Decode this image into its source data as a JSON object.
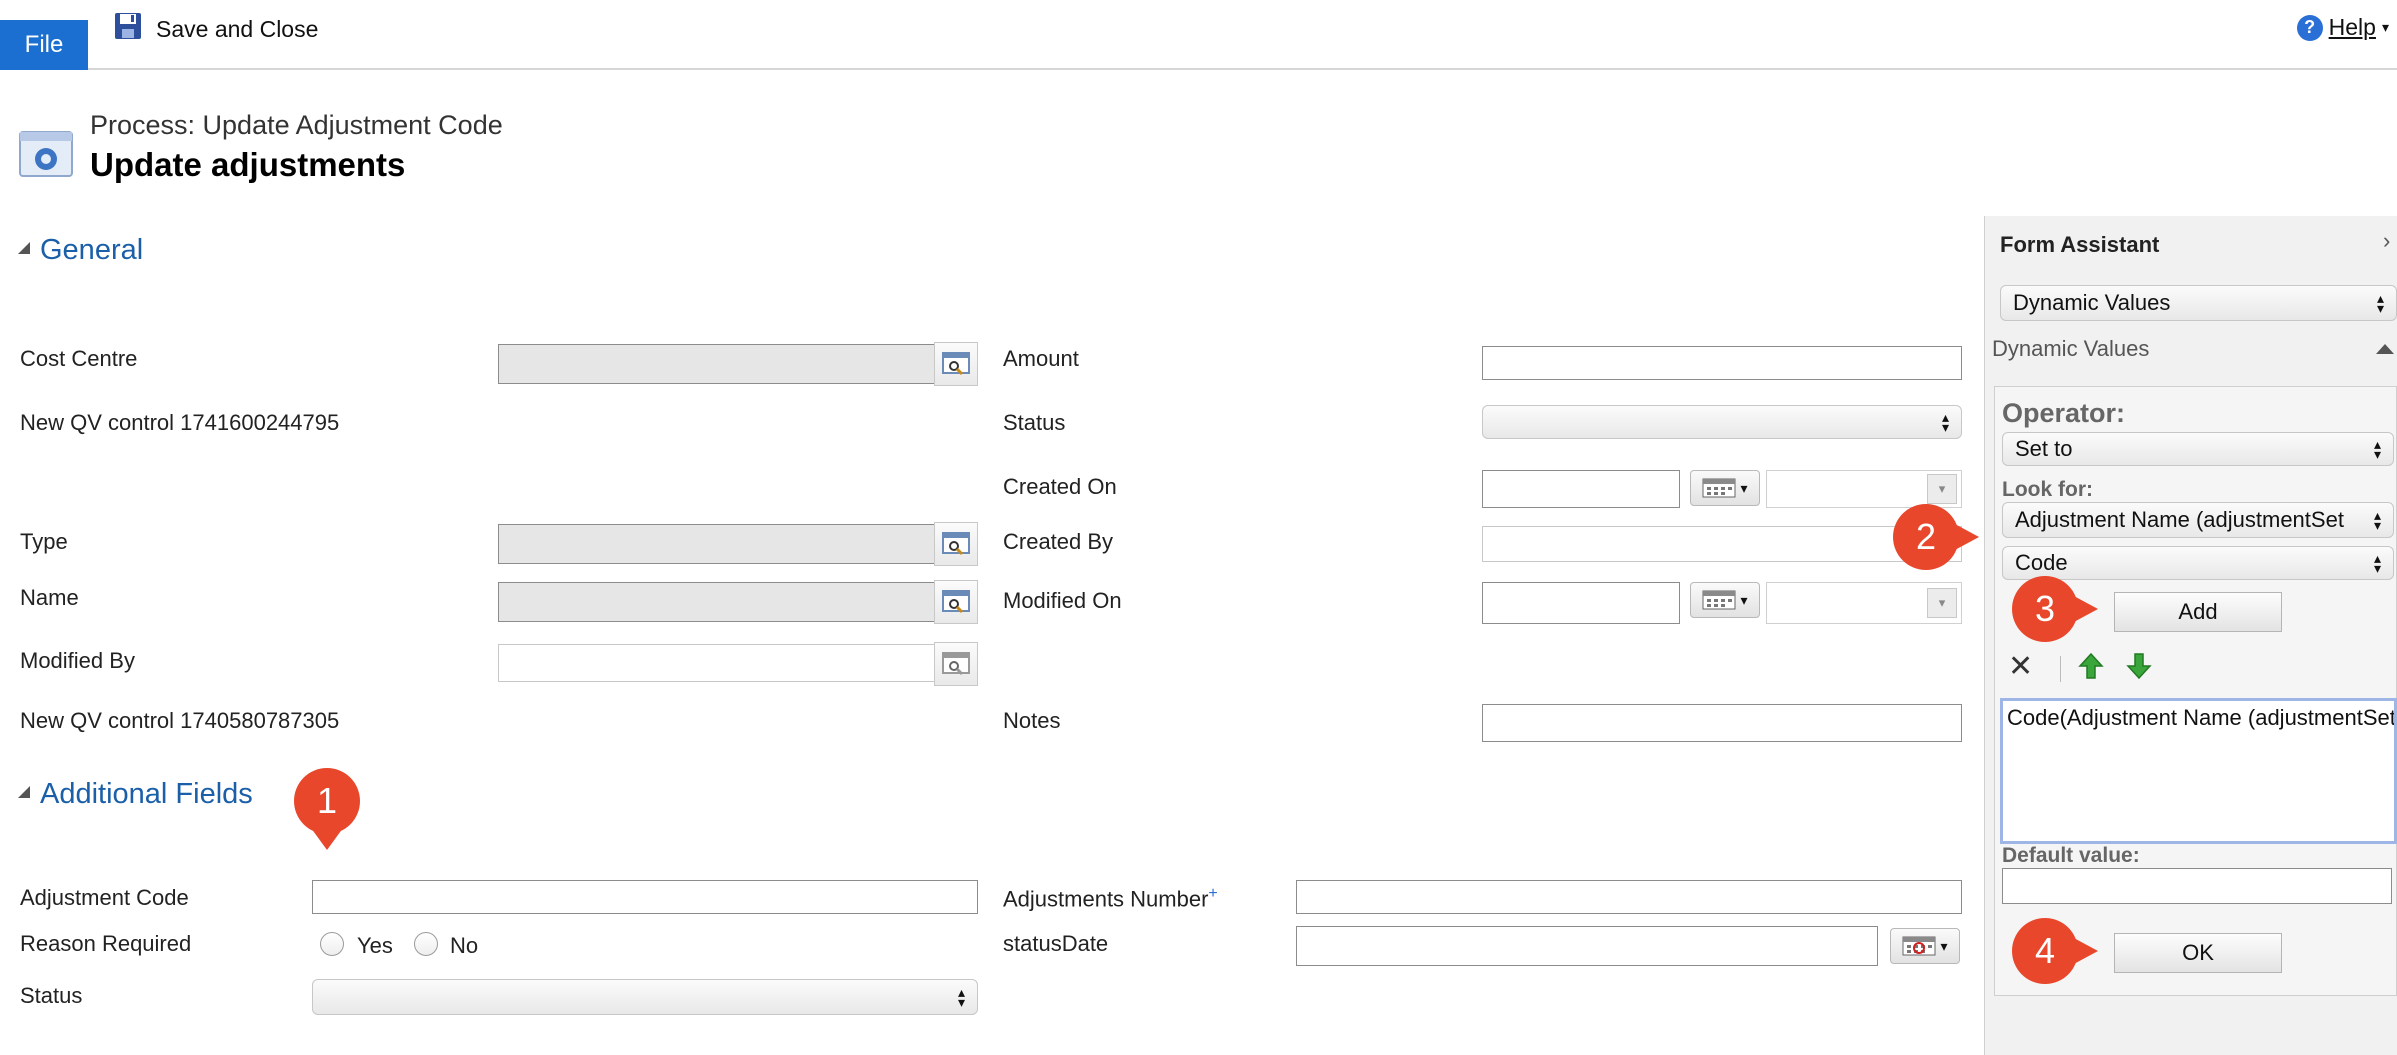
{
  "ribbon": {
    "file_label": "File",
    "save_close_label": "Save and Close",
    "help_label": "Help"
  },
  "header": {
    "process_name": "Process: Update Adjustment Code",
    "title": "Update adjustments"
  },
  "general": {
    "section_title": "General",
    "cost_centre_label": "Cost Centre",
    "qv_control_1_label": "New QV control 1741600244795",
    "type_label": "Type",
    "name_label": "Name",
    "modified_by_label": "Modified By",
    "qv_control_2_label": "New QV control 1740580787305",
    "amount_label": "Amount",
    "status_label": "Status",
    "created_on_label": "Created On",
    "created_by_label": "Created By",
    "modified_on_label": "Modified On",
    "notes_label": "Notes"
  },
  "additional": {
    "section_title": "Additional Fields",
    "adjustment_code_label": "Adjustment Code",
    "reason_required_label": "Reason Required",
    "yes_label": "Yes",
    "no_label": "No",
    "status_label": "Status",
    "adjustments_number_label": "Adjustments Number",
    "adjustments_number_marker": "+",
    "status_date_label": "statusDate"
  },
  "form_assistant": {
    "title": "Form Assistant",
    "top_select_value": "Dynamic Values",
    "section_label": "Dynamic Values",
    "operator_heading": "Operator:",
    "operator_value": "Set to",
    "look_for_label": "Look for:",
    "look_for_entity": "Adjustment Name (adjustmentSet",
    "look_for_field": "Code",
    "add_label": "Add",
    "expression_value": "Code(Adjustment Name (adjustmentSet",
    "default_value_label": "Default value:",
    "ok_label": "OK"
  },
  "callouts": [
    "1",
    "2",
    "3",
    "4"
  ],
  "colors": {
    "accent_blue": "#1b6fd0",
    "section_blue": "#1a5fa8",
    "callout_red": "#e8472b",
    "arrow_green": "#3aa53a"
  }
}
